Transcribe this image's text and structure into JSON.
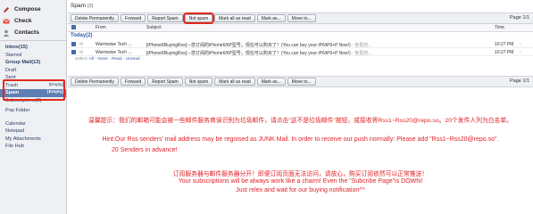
{
  "sidebar": {
    "nav": [
      {
        "label": "Compose",
        "icon": "compose-icon"
      },
      {
        "label": "Check",
        "icon": "check-mail-icon"
      },
      {
        "label": "Contacts",
        "icon": "contacts-icon"
      }
    ],
    "folders": [
      {
        "label": "Inbox(15)",
        "bold": true
      },
      {
        "label": "Starred",
        "bold": false
      },
      {
        "label": "Group Mail(13)",
        "bold": true
      },
      {
        "label": "Draft",
        "bold": false
      },
      {
        "label": "Sent",
        "bold": false
      }
    ],
    "trash": {
      "label": "Trash",
      "count": "[Empty]"
    },
    "spam": {
      "label": "Spam",
      "count": "[Empty]"
    },
    "subscribe": {
      "label": "Subscriptions(2)"
    },
    "pop_folder": "Pop Folder",
    "links": [
      "Calendar",
      "Notepad",
      "My Attachments",
      "File Hub"
    ]
  },
  "main": {
    "title": "Spam",
    "title_count": "(2)",
    "toolbar": {
      "delete_permanently": "Delete Permanently",
      "forward": "Forward",
      "report_spam": "Report Spam",
      "not_spam": "Not spam",
      "mark_all_read": "Mark all as read",
      "mark_as": "Mark as...",
      "move_to": "Move to...",
      "page": "Page 1/1"
    },
    "columns": {
      "from": "From",
      "subject": "Subject",
      "time": "Time"
    },
    "group_label": "Today(2)",
    "rows": [
      {
        "from": "Warmwise Tech ...",
        "subject": "[iPhone6BuyingRss]---您订阅的iPhone6/6P型号，现在可以购买了！(You can buy your iP6/iP6+P Now!)",
        "preview": " - 亲爱的...",
        "time": "10:27 PM"
      },
      {
        "from": "Warmwise Tech ...",
        "subject": "[iPhone6BuyingRss]---您订阅的iPhone6/6P型号，现在可以购买了！(You can buy your iP6/iP6+P Now!)",
        "preview": " - 亲爱的...",
        "time": "10:27 PM"
      }
    ],
    "selbar": {
      "prefix": "Select:",
      "all": "All",
      "none": "None",
      "read": "Read",
      "unread": "Unread"
    }
  },
  "message": {
    "p1": "温馨提示：我们的邮箱可能会被一些邮件服务商误识别为垃圾邮件，请点击\"这不是垃圾邮件\"按钮，或接收将Rss1~Rss20@repo.so。20个发件人列为白名单。",
    "p2": "Hint:Our Rss senders' mail address may be regnised as JUNK Mail. In order to receive our push normally: Please add \"Rss1~Rss20@repo.so\".",
    "p2b": "20 Senders in advance!",
    "p3": "订阅服务器与邮件服务器分开！即便订阅页面无法访问，请放心，购买订阅依然可以正常推送！",
    "p4": "Your subscriptions will be always work like a charm! Even the \"Subcribe Page\"is DOWN!",
    "p5": "Just relex and wait for our buying notification^^"
  },
  "colors": {
    "accent_red": "#e21f26",
    "selected_folder": "#5f7eb4",
    "link": "#2f5ea6"
  }
}
